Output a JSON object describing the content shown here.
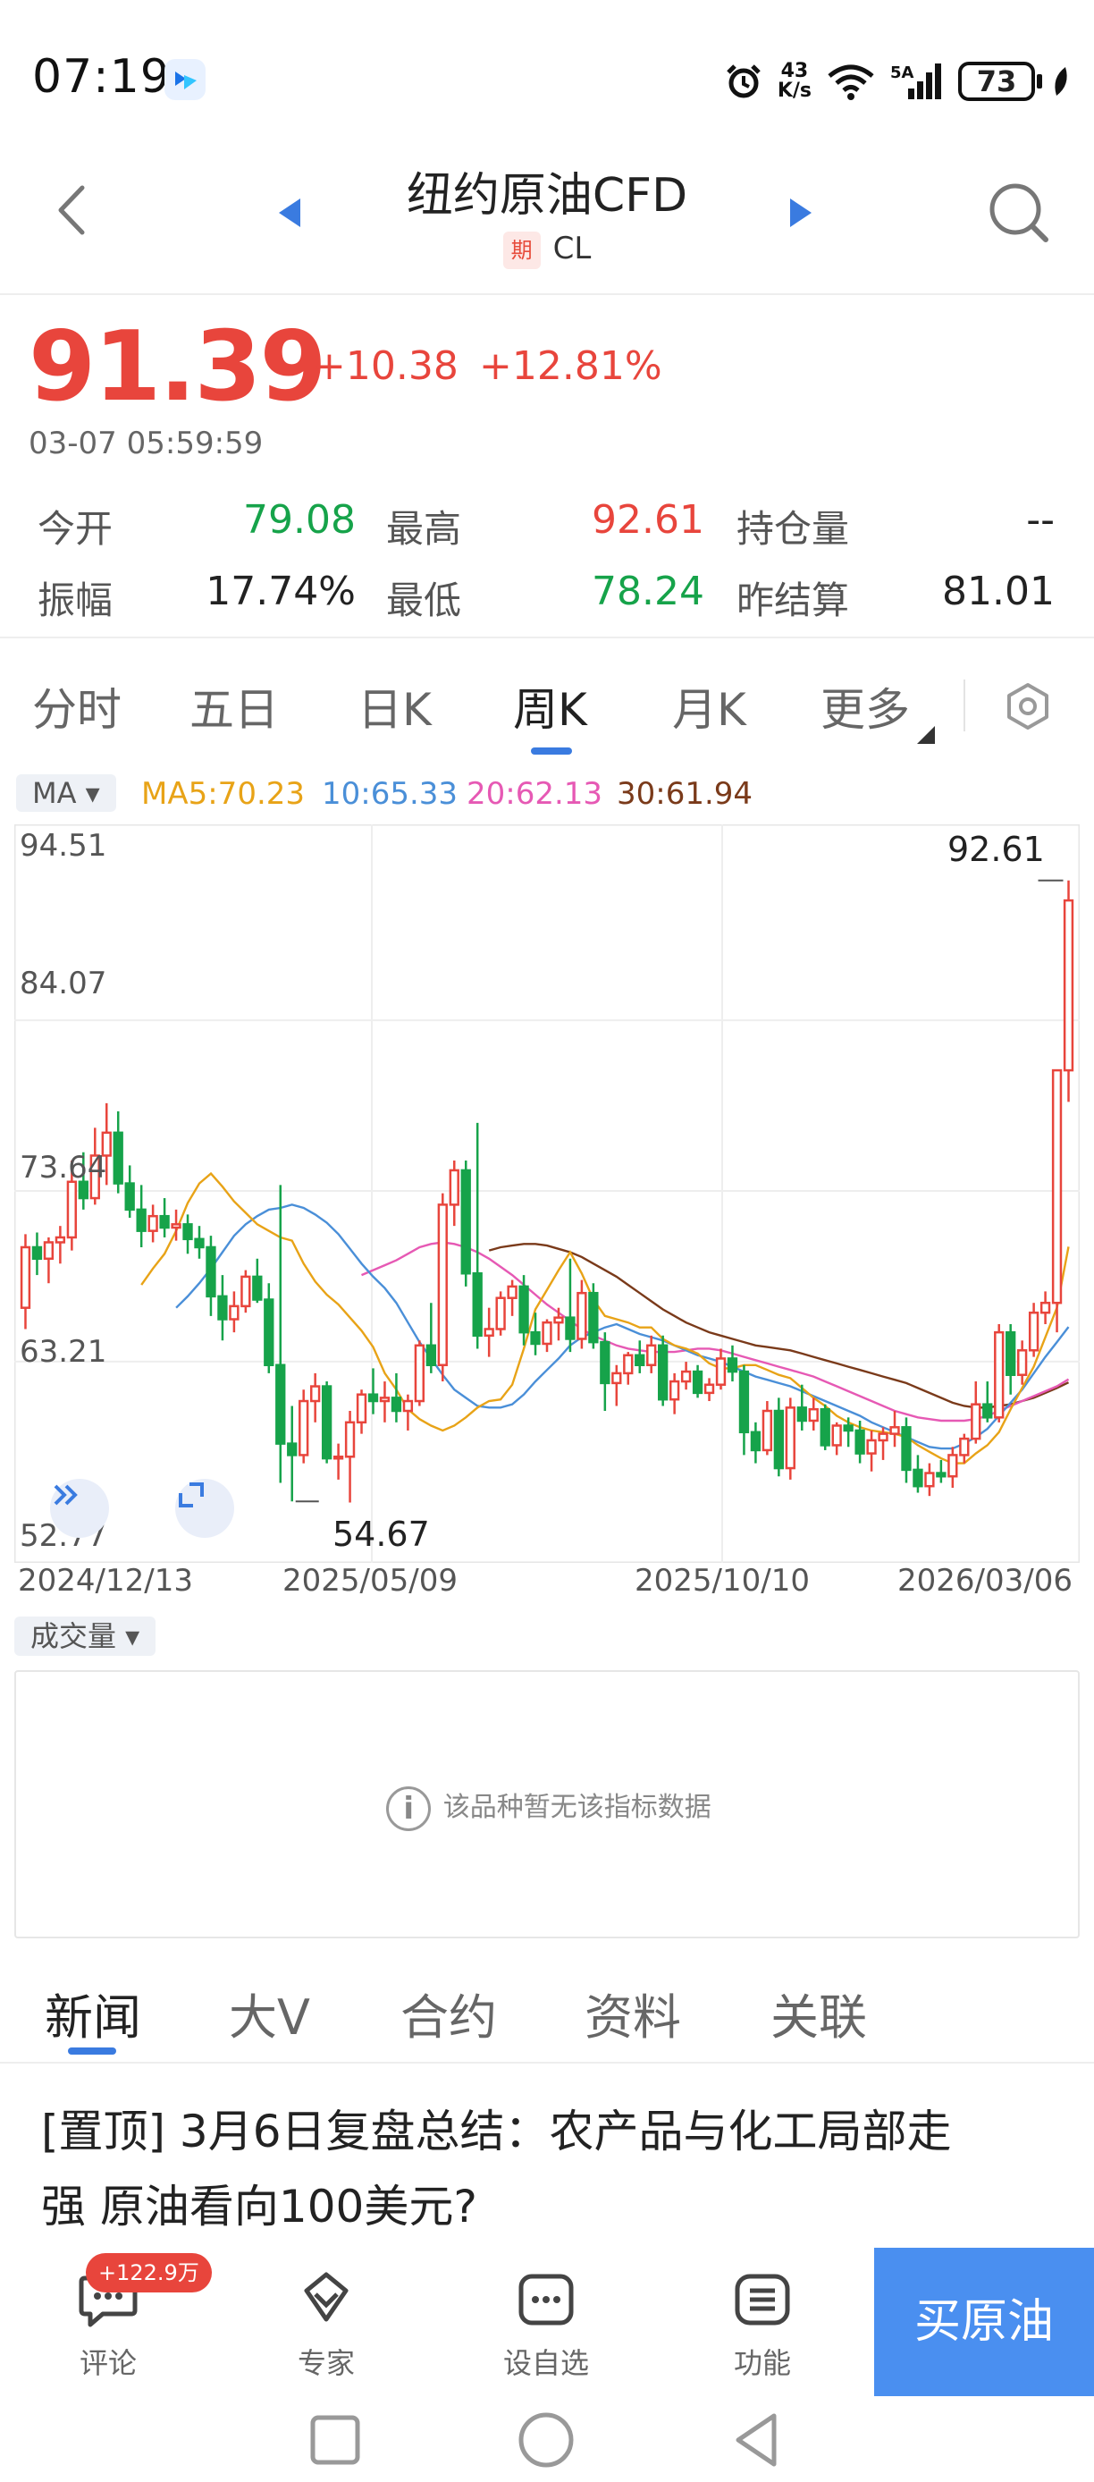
{
  "status_bar": {
    "time": "07:19",
    "net_speed_top": "43",
    "net_speed_bottom": "K/s",
    "battery": "73"
  },
  "header": {
    "title": "纽约原油CFD",
    "badge": "期",
    "code": "CL"
  },
  "quote": {
    "price": "91.39",
    "change": "+10.38",
    "change_pct": "+12.81%",
    "timestamp": "03-07 05:59:59"
  },
  "stats": {
    "open_label": "今开",
    "open_value": "79.08",
    "high_label": "最高",
    "high_value": "92.61",
    "oi_label": "持仓量",
    "oi_value": "--",
    "amp_label": "振幅",
    "amp_value": "17.74%",
    "low_label": "最低",
    "low_value": "78.24",
    "settle_label": "昨结算",
    "settle_value": "81.01"
  },
  "period_tabs": {
    "t0": "分时",
    "t1": "五日",
    "t2": "日K",
    "t3": "周K",
    "t4": "月K",
    "t5": "更多"
  },
  "ma_legend": {
    "button": "MA ▾",
    "ma5": "MA5:70.23",
    "ma10": "10:65.33",
    "ma20": "20:62.13",
    "ma30": "30:61.94"
  },
  "colors": {
    "up": "#e8453c",
    "down": "#16a34a",
    "accent": "#3a7be0",
    "ma5": "#e8a317",
    "ma10": "#4a8fd8",
    "ma20": "#e659b4",
    "ma30": "#7a3a1a"
  },
  "chart_data": {
    "type": "candlestick",
    "y_ticks": [
      "94.51",
      "84.07",
      "73.64",
      "63.21",
      "52.77"
    ],
    "ylim": [
      52.77,
      94.51
    ],
    "x_ticks": [
      "2024/12/13",
      "2025/05/09",
      "2025/10/10",
      "2026/03/06"
    ],
    "max_label": "92.61",
    "min_label": "54.67",
    "grid": true,
    "candles": [
      [
        66.5,
        71.0,
        65.2,
        70.2
      ],
      [
        70.2,
        71.1,
        68.5,
        69.5
      ],
      [
        69.5,
        70.8,
        68.0,
        70.5
      ],
      [
        70.5,
        71.5,
        69.2,
        70.8
      ],
      [
        70.8,
        75.5,
        70.0,
        74.2
      ],
      [
        74.2,
        76.0,
        72.5,
        73.2
      ],
      [
        73.2,
        77.5,
        72.8,
        75.8
      ],
      [
        75.8,
        79.0,
        74.0,
        77.2
      ],
      [
        77.2,
        78.5,
        73.5,
        74.1
      ],
      [
        74.1,
        75.2,
        72.0,
        72.5
      ],
      [
        72.5,
        74.0,
        70.2,
        71.2
      ],
      [
        71.2,
        72.8,
        70.5,
        72.1
      ],
      [
        72.1,
        73.2,
        70.8,
        71.4
      ],
      [
        71.4,
        72.5,
        70.6,
        71.6
      ],
      [
        71.6,
        72.2,
        69.8,
        70.7
      ],
      [
        70.7,
        71.5,
        69.5,
        70.2
      ],
      [
        70.2,
        70.9,
        66.0,
        67.2
      ],
      [
        67.2,
        68.5,
        64.5,
        65.8
      ],
      [
        65.8,
        67.5,
        65.0,
        66.6
      ],
      [
        66.6,
        68.8,
        66.2,
        68.4
      ],
      [
        68.4,
        69.5,
        66.8,
        67.0
      ],
      [
        67.0,
        68.0,
        62.5,
        63.0
      ],
      [
        63.0,
        74.0,
        55.8,
        58.2
      ],
      [
        58.2,
        60.5,
        54.67,
        57.5
      ],
      [
        57.5,
        61.5,
        57.0,
        60.8
      ],
      [
        60.8,
        62.5,
        59.5,
        61.7
      ],
      [
        61.7,
        62.0,
        57.0,
        57.3
      ],
      [
        57.3,
        58.2,
        56.0,
        57.4
      ],
      [
        57.4,
        60.2,
        54.6,
        59.5
      ],
      [
        59.5,
        61.5,
        58.8,
        61.2
      ],
      [
        61.2,
        62.8,
        60.0,
        60.8
      ],
      [
        60.8,
        62.0,
        59.5,
        61.0
      ],
      [
        61.0,
        62.5,
        59.5,
        60.2
      ],
      [
        60.2,
        61.2,
        59.0,
        60.8
      ],
      [
        60.8,
        64.5,
        60.5,
        64.2
      ],
      [
        64.2,
        66.8,
        62.5,
        63.0
      ],
      [
        63.0,
        73.5,
        62.0,
        72.8
      ],
      [
        72.8,
        75.5,
        71.5,
        74.9
      ],
      [
        74.9,
        75.5,
        67.8,
        68.6
      ],
      [
        68.6,
        77.8,
        64.0,
        64.8
      ],
      [
        64.8,
        66.5,
        63.5,
        65.2
      ],
      [
        65.2,
        67.5,
        64.8,
        67.1
      ],
      [
        67.1,
        68.2,
        66.0,
        67.8
      ],
      [
        67.8,
        68.5,
        64.2,
        65.0
      ],
      [
        65.0,
        66.2,
        63.6,
        64.3
      ],
      [
        64.3,
        65.8,
        63.8,
        65.6
      ],
      [
        65.6,
        66.5,
        64.5,
        65.9
      ],
      [
        65.9,
        69.5,
        63.8,
        64.6
      ],
      [
        64.6,
        68.2,
        64.0,
        67.4
      ],
      [
        67.4,
        68.0,
        64.0,
        64.4
      ],
      [
        64.4,
        65.0,
        60.2,
        61.9
      ],
      [
        61.9,
        63.0,
        60.5,
        62.5
      ],
      [
        62.5,
        63.8,
        61.8,
        63.6
      ],
      [
        63.6,
        64.5,
        62.5,
        63.0
      ],
      [
        63.0,
        64.8,
        62.5,
        64.2
      ],
      [
        64.2,
        64.8,
        60.5,
        60.9
      ],
      [
        60.9,
        62.5,
        60.0,
        62.0
      ],
      [
        62.0,
        63.2,
        61.5,
        62.6
      ],
      [
        62.6,
        63.0,
        61.0,
        61.3
      ],
      [
        61.3,
        62.2,
        60.8,
        61.8
      ],
      [
        61.8,
        64.0,
        61.5,
        63.4
      ],
      [
        63.4,
        64.2,
        62.0,
        62.6
      ],
      [
        62.6,
        63.0,
        57.5,
        58.9
      ],
      [
        58.9,
        59.5,
        57.0,
        57.8
      ],
      [
        57.8,
        60.8,
        57.5,
        60.2
      ],
      [
        60.2,
        61.0,
        56.2,
        56.7
      ],
      [
        56.7,
        61.0,
        56.0,
        60.4
      ],
      [
        60.4,
        61.8,
        59.0,
        59.6
      ],
      [
        59.6,
        61.0,
        59.0,
        60.3
      ],
      [
        60.3,
        60.6,
        57.8,
        58.1
      ],
      [
        58.1,
        59.5,
        57.5,
        59.3
      ],
      [
        59.3,
        59.8,
        58.0,
        59.0
      ],
      [
        59.0,
        59.6,
        57.0,
        57.6
      ],
      [
        57.6,
        59.0,
        56.5,
        58.4
      ],
      [
        58.4,
        59.2,
        57.2,
        58.8
      ],
      [
        58.8,
        60.2,
        58.0,
        59.2
      ],
      [
        59.2,
        59.8,
        55.8,
        56.6
      ],
      [
        56.6,
        57.5,
        55.2,
        55.6
      ],
      [
        55.6,
        57.0,
        55.0,
        56.4
      ],
      [
        56.4,
        57.2,
        55.8,
        56.2
      ],
      [
        56.2,
        58.0,
        55.5,
        57.5
      ],
      [
        57.5,
        58.8,
        57.0,
        58.5
      ],
      [
        58.5,
        62.0,
        58.2,
        60.6
      ],
      [
        60.6,
        62.0,
        59.5,
        59.8
      ],
      [
        59.8,
        65.5,
        59.5,
        65.0
      ],
      [
        65.0,
        65.5,
        61.2,
        62.4
      ],
      [
        62.4,
        64.5,
        61.8,
        63.9
      ],
      [
        63.9,
        66.8,
        63.5,
        66.2
      ],
      [
        66.2,
        67.5,
        65.5,
        66.8
      ],
      [
        66.8,
        67.2,
        65.0,
        81.01
      ],
      [
        81.01,
        92.61,
        79.08,
        91.39
      ]
    ],
    "ma5": [
      67.9,
      68.9,
      69.8,
      71.2,
      72.9,
      74.1,
      74.7,
      73.9,
      73.0,
      72.3,
      71.6,
      71.2,
      70.8,
      70.6,
      69.2,
      68.1,
      67.3,
      66.7,
      65.9,
      65.1,
      64.1,
      62.5,
      61.5,
      60.3,
      59.7,
      59.3,
      59.0,
      59.3,
      59.8,
      60.4,
      60.8,
      60.9,
      61.8,
      64.0,
      66.4,
      67.6,
      68.8,
      69.9,
      68.6,
      67.0,
      66.0,
      65.8,
      65.6,
      65.3,
      65.3,
      64.6,
      64.2,
      64.0,
      63.7,
      63.1,
      62.8,
      62.8,
      63.0,
      63.0,
      62.7,
      62.4,
      62.2,
      61.6,
      61.0,
      60.5,
      59.9,
      59.5,
      59.2,
      59.0,
      58.9,
      58.8,
      58.6,
      58.1,
      57.7,
      57.3,
      57.0,
      57.0,
      57.6,
      58.1,
      58.9,
      60.3,
      61.6,
      62.9,
      64.7,
      66.5,
      70.23
    ],
    "ma10": [
      66.5,
      67.2,
      68.0,
      68.9,
      69.9,
      70.9,
      71.6,
      72.1,
      72.5,
      72.6,
      72.8,
      72.6,
      72.2,
      71.7,
      71.0,
      70.1,
      69.2,
      68.4,
      67.7,
      66.8,
      65.6,
      64.4,
      63.4,
      62.4,
      61.5,
      61.0,
      60.5,
      60.4,
      60.4,
      60.6,
      61.2,
      62.0,
      62.7,
      63.4,
      64.2,
      64.7,
      65.0,
      65.3,
      65.5,
      65.2,
      64.9,
      64.7,
      64.5,
      64.2,
      63.9,
      63.6,
      63.4,
      63.2,
      62.9,
      62.6,
      62.3,
      62.1,
      61.9,
      61.7,
      61.4,
      61.1,
      60.8,
      60.5,
      60.2,
      59.9,
      59.5,
      59.2,
      58.9,
      58.6,
      58.3,
      58.0,
      57.9,
      57.9,
      58.2,
      58.6,
      59.1,
      59.9,
      60.7,
      61.5,
      62.5,
      63.5,
      64.4,
      65.33
    ],
    "ma20": [
      68.5,
      68.8,
      69.1,
      69.4,
      69.8,
      70.2,
      70.4,
      70.5,
      70.4,
      70.2,
      69.9,
      69.5,
      69.0,
      68.5,
      67.9,
      67.3,
      66.7,
      66.2,
      65.7,
      65.2,
      64.8,
      64.5,
      64.2,
      64.0,
      63.9,
      63.8,
      63.8,
      63.8,
      63.9,
      64.0,
      64.0,
      63.9,
      63.7,
      63.5,
      63.3,
      63.1,
      62.9,
      62.7,
      62.5,
      62.3,
      62.0,
      61.7,
      61.4,
      61.1,
      60.8,
      60.5,
      60.2,
      60.0,
      59.8,
      59.7,
      59.6,
      59.6,
      59.6,
      59.7,
      59.9,
      60.2,
      60.5,
      60.8,
      61.1,
      61.4,
      61.7,
      62.13
    ],
    "ma30": [
      70.0,
      70.2,
      70.3,
      70.4,
      70.4,
      70.3,
      70.1,
      69.9,
      69.6,
      69.2,
      68.8,
      68.4,
      67.9,
      67.4,
      66.9,
      66.4,
      66.0,
      65.6,
      65.3,
      65.0,
      64.8,
      64.6,
      64.4,
      64.2,
      64.1,
      64.0,
      63.9,
      63.7,
      63.5,
      63.3,
      63.1,
      62.9,
      62.7,
      62.5,
      62.3,
      62.1,
      61.9,
      61.6,
      61.3,
      61.0,
      60.7,
      60.5,
      60.4,
      60.4,
      60.5,
      60.6,
      60.8,
      61.0,
      61.3,
      61.6,
      61.94
    ]
  },
  "volume": {
    "button": "成交量 ▾",
    "empty_msg": "该品种暂无该指标数据"
  },
  "news_tabs": {
    "t0": "新闻",
    "t1": "大V",
    "t2": "合约",
    "t3": "资料",
    "t4": "关联"
  },
  "news": {
    "line1": "[置顶] 3月6日复盘总结：农产品与化工局部走",
    "line2": "强 原油看向100美元?"
  },
  "bottom_bar": {
    "comment_badge": "+122.9万",
    "comment": "评论",
    "expert": "专家",
    "watchlist": "设自选",
    "function": "功能",
    "buy": "买原油"
  }
}
